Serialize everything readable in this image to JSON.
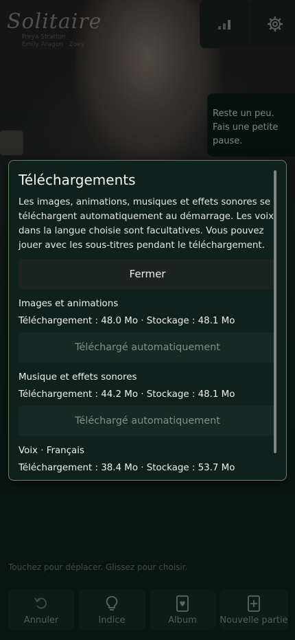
{
  "app": {
    "logo_title": "Solitaire",
    "logo_sub_1": "Freya Stratton",
    "logo_sub_2": "Emily Aragon · Zoey"
  },
  "top_buttons": [
    {
      "name": "stats-icon"
    },
    {
      "name": "gear-icon"
    }
  ],
  "speech_bubble": "Reste un peu. Fais une petite pause.",
  "modal": {
    "title": "Téléchargements",
    "description": "Les images, animations, musiques et effets sonores se téléchargent automatiquement au démarrage. Les voix dans la langue choisie sont facultatives. Vous pouvez jouer avec les sous-titres pendant le téléchargement.",
    "close_label": "Fermer",
    "sections": [
      {
        "name": "Images et animations",
        "info": "Téléchargement : 48.0 Mo · Stockage : 48.1 Mo",
        "status": "Téléchargé automatiquement"
      },
      {
        "name": "Musique et effets sonores",
        "info": "Téléchargement : 44.2 Mo · Stockage : 48.1 Mo",
        "status": "Téléchargé automatiquement"
      },
      {
        "name": "Voix · Français",
        "info": "Téléchargement : 38.4 Mo · Stockage : 53.7 Mo"
      }
    ]
  },
  "hint": "Touchez pour déplacer. Glissez pour choisir.",
  "bottom_bar": {
    "undo_label": "Annuler",
    "hint_label": "Indice",
    "album_label": "Album",
    "new_game_label": "Nouvelle partie"
  }
}
